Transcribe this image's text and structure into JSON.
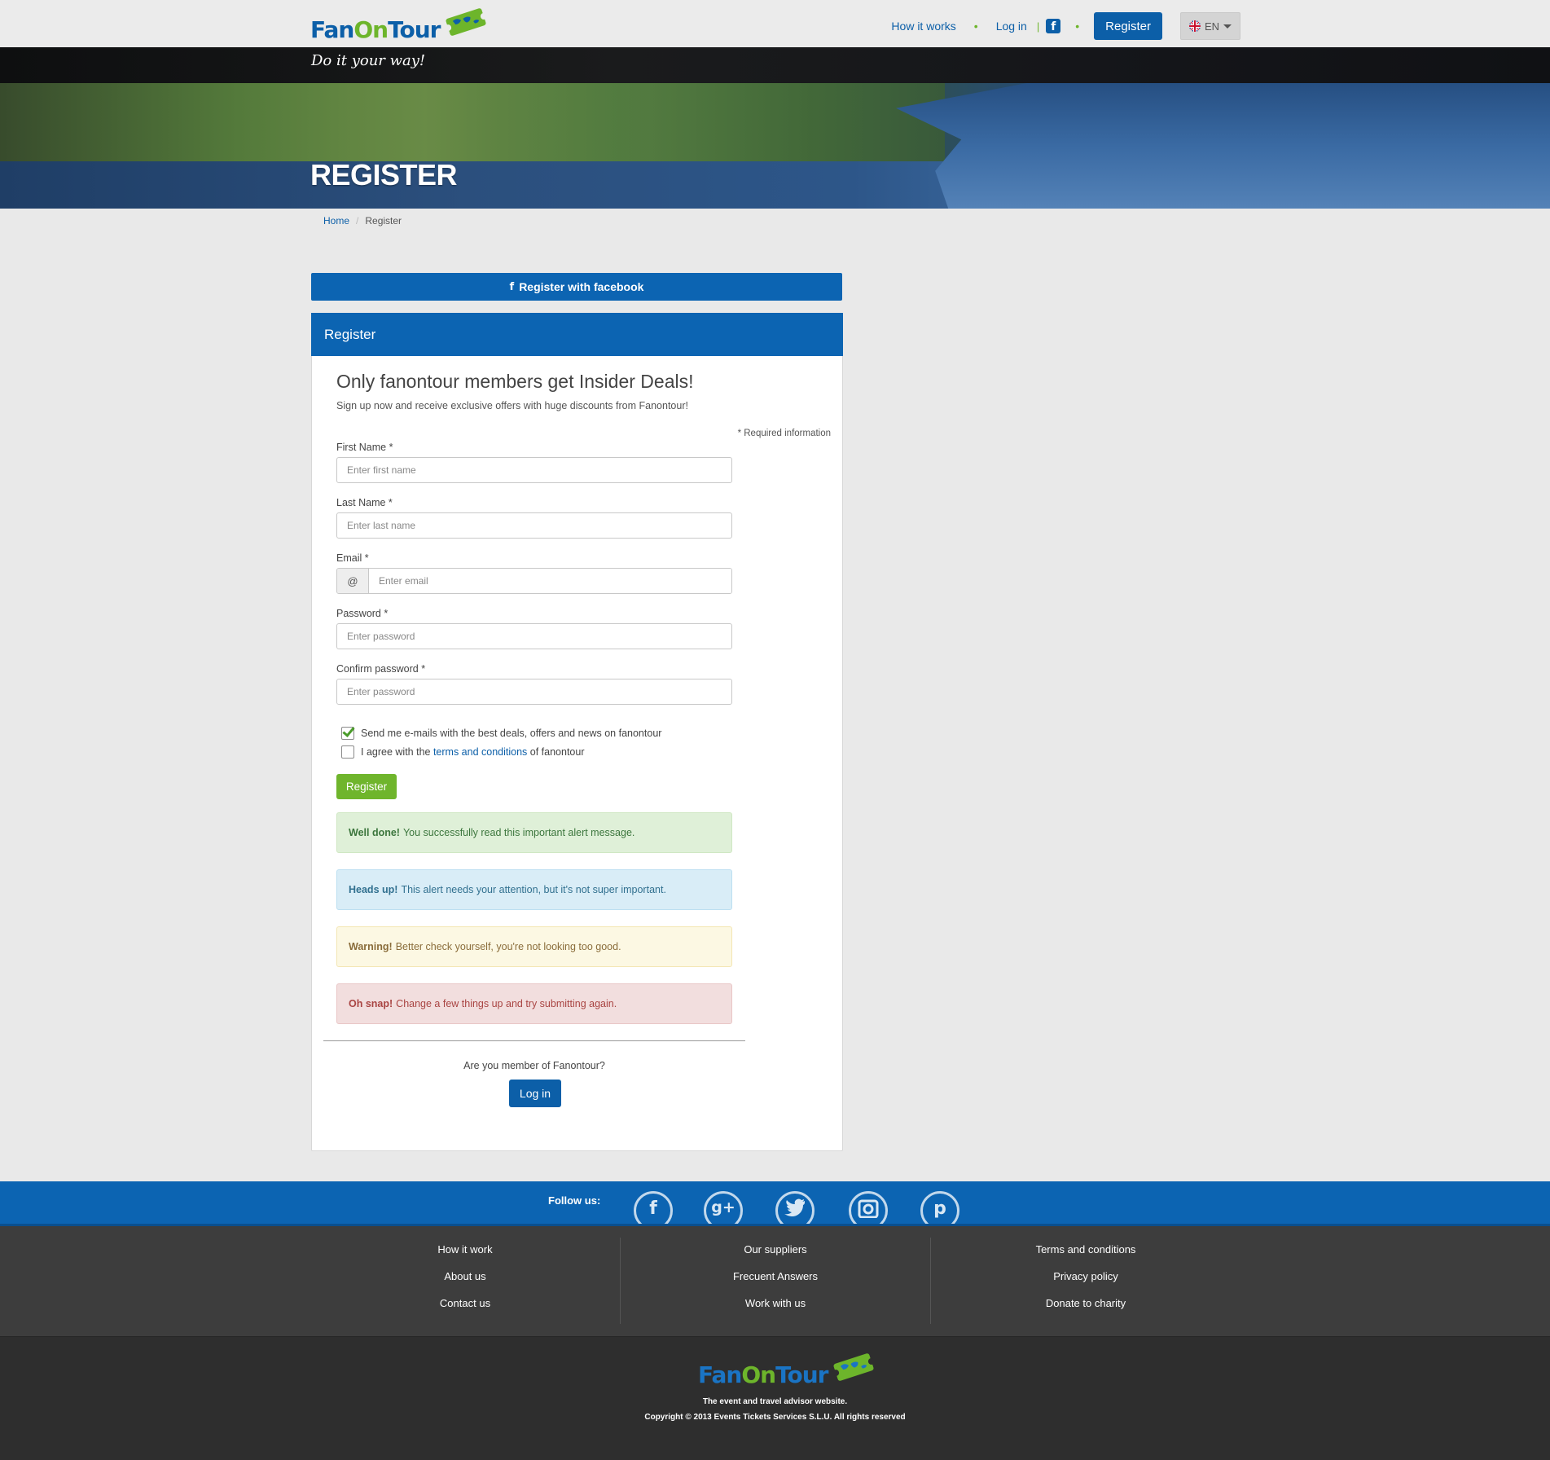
{
  "brand": {
    "name_part1": "Fan",
    "name_part2": "On",
    "name_part3": "Tour",
    "tagline": "Do it your way!"
  },
  "topnav": {
    "how_it_works": "How it works",
    "login": "Log in",
    "register": "Register",
    "language": "EN"
  },
  "hero": {
    "title": "REGISTER"
  },
  "breadcrumb": {
    "home": "Home",
    "current": "Register"
  },
  "facebook_button": {
    "label": "Register with facebook",
    "icon": "f"
  },
  "panel": {
    "title": "Register",
    "heading": "Only fanontour members get Insider Deals!",
    "subheading": "Sign up now and receive exclusive offers with huge discounts from Fanontour!",
    "required_note": "* Required information",
    "fields": {
      "first_name": {
        "label": "First Name *",
        "placeholder": "Enter first name",
        "value": ""
      },
      "last_name": {
        "label": "Last Name *",
        "placeholder": "Enter last name",
        "value": ""
      },
      "email": {
        "label": "Email *",
        "placeholder": "Enter email",
        "addon": "@",
        "value": ""
      },
      "password": {
        "label": "Password *",
        "placeholder": "Enter password",
        "value": ""
      },
      "confirm_password": {
        "label": "Confirm password *",
        "placeholder": "Enter password",
        "value": ""
      }
    },
    "checkboxes": {
      "newsletter": {
        "label": "Send me e-mails with the best deals, offers and news on fanontour",
        "checked": true
      },
      "terms": {
        "prefix": "I agree with the",
        "link": "terms and conditions",
        "suffix": "of fanontour",
        "checked": false
      }
    },
    "submit_label": "Register",
    "alerts": {
      "success": {
        "strong": "Well done!",
        "text": "You successfully read this important alert message."
      },
      "info": {
        "strong": "Heads up!",
        "text": "This alert needs your attention, but it's not super important."
      },
      "warning": {
        "strong": "Warning!",
        "text": "Better check yourself, you're not looking too good."
      },
      "danger": {
        "strong": "Oh snap!",
        "text": "Change a few things up and try submitting again."
      }
    },
    "member_question": "Are you member of Fanontour?",
    "login_label": "Log in"
  },
  "footer": {
    "follow_label": "Follow us:",
    "social": [
      "f",
      "g+",
      "t",
      "o",
      "p"
    ],
    "columns": [
      [
        "How it work",
        "About us",
        "Contact us"
      ],
      [
        "Our suppliers",
        "Frecuent Answers",
        "Work with us"
      ],
      [
        "Terms and conditions",
        "Privacy policy",
        "Donate to charity"
      ]
    ],
    "slogan": "The event and travel advisor website.",
    "copyright": "Copyright © 2013 Events Tickets Services S.L.U. All rights reserved"
  },
  "colors": {
    "brand_blue": "#0c5fa8",
    "brand_green": "#6db52b",
    "page_bg": "#e9e9e9",
    "footer_dark": "#3d3d3d"
  }
}
